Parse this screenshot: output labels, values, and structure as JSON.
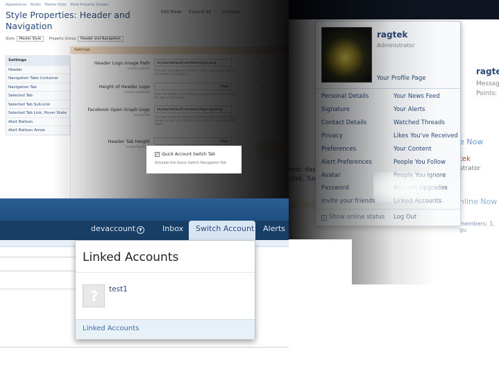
{
  "admin": {
    "breadcrumbs": [
      "Appearance",
      "Styles",
      "Master Style",
      "Style Property Groups"
    ],
    "title": "Style Properties: Header and Navigation",
    "style_label": "Style:",
    "style_value": "Master Style",
    "group_label": "Property Group:",
    "group_value": "Header and Navigation",
    "top_buttons": [
      "Edit Mode",
      "Expand All",
      "Collapse"
    ],
    "settings_header": "Settings",
    "sidebar": [
      "Settings",
      "Header",
      "Navigation Tabs Container",
      "Navigation Tab",
      "Selected Tab",
      "Selected Tab Sub-Link",
      "Selected Tab Link, Hover State",
      "Alert Balloon",
      "Alert Balloon Arrow"
    ],
    "rows": [
      {
        "label": "Header Logo Image Path",
        "sub": "headerLogoPath",
        "value": "styles/default/xenforo/logo.png",
        "help": "This path describes the location of the logo image used in the header of all pages."
      },
      {
        "label": "Height of Header Logo",
        "sub": "headerLogoHeight",
        "value": "50px",
        "help": "Enter the height in pixels that you would like to reserve for the logo in the header."
      },
      {
        "label": "Facebook Open Graph Logo",
        "sub": "ogLogoPath",
        "value": "styles/default/xenforo/logo.og.png",
        "help": "This logo will be displayed in Facebook when a visitor likes a page on your site. Must be at least 50x50 and should be square."
      },
      {
        "label": "Header Tab Height",
        "sub": "headerTabHeight",
        "value": "25px",
        "help": ""
      }
    ],
    "quick_switch_label": "Quick Account Switch Tab",
    "quick_switch_hint": "Activate the Quick Switch Navigation Tab"
  },
  "account_menu": {
    "username": "ragtek",
    "role": "Administrator",
    "profile_link": "Your Profile Page",
    "left_links": [
      "Personal Details",
      "Signature",
      "Contact Details",
      "Privacy",
      "Preferences",
      "Alert Preferences",
      "Avatar",
      "Password",
      "Invite your friends"
    ],
    "right_links": [
      "Your News Feed",
      "Your Alerts",
      "Watched Threads",
      "Likes You've Received",
      "Your Content",
      "People You Follow",
      "People You Ignore",
      "Account Upgrades",
      "Linked Accounts"
    ],
    "show_online": "Show online status",
    "logout": "Log Out",
    "behind": {
      "username": "ragtek",
      "meta": [
        "Message",
        "Points:"
      ],
      "thread_line1": "test: dasd",
      "thread_line2": "gtek, Tues",
      "online_now_1": "e Now",
      "staff_name": "tek",
      "staff_role": "strator",
      "online_now_2": "nline Now",
      "members": "members: 1, gu"
    }
  },
  "nav": {
    "user": "devaccount",
    "inbox": "Inbox",
    "switch_account": "Switch Account",
    "alerts": "Alerts"
  },
  "linked_popup": {
    "title": "Linked Accounts",
    "account": "test1",
    "footer_link": "Linked Accounts"
  }
}
